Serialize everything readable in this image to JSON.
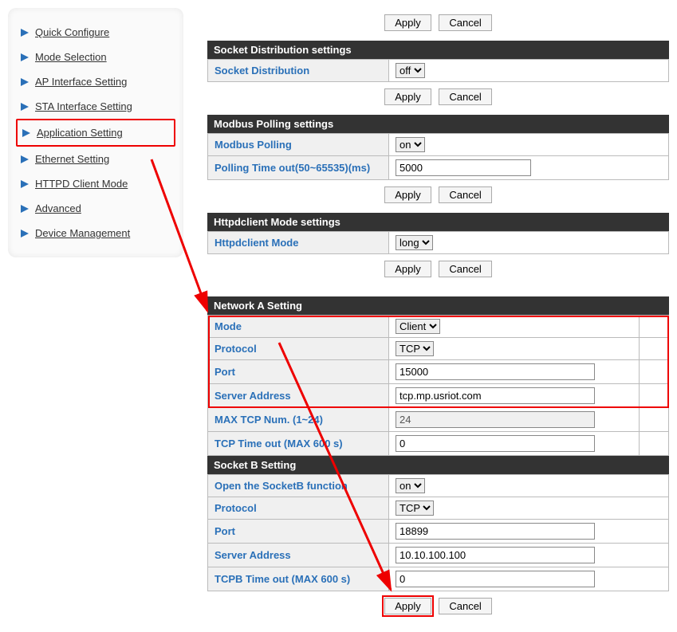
{
  "sidebar": {
    "items": [
      {
        "label": "Quick Configure"
      },
      {
        "label": "Mode Selection"
      },
      {
        "label": "AP Interface Setting"
      },
      {
        "label": "STA Interface Setting"
      },
      {
        "label": "Application Setting"
      },
      {
        "label": "Ethernet Setting"
      },
      {
        "label": "HTTPD Client Mode"
      },
      {
        "label": "Advanced"
      },
      {
        "label": "Device Management"
      }
    ]
  },
  "buttons": {
    "apply": "Apply",
    "cancel": "Cancel"
  },
  "sections": {
    "socketDist": {
      "header": "Socket Distribution settings",
      "row_label": "Socket Distribution",
      "value": "off"
    },
    "modbus": {
      "header": "Modbus Polling settings",
      "row1_label": "Modbus Polling",
      "row1_value": "on",
      "row2_label": "Polling Time out(50~65535)(ms)",
      "row2_value": "5000"
    },
    "httpd": {
      "header": "Httpdclient Mode settings",
      "row_label": "Httpdclient Mode",
      "value": "long"
    },
    "netA": {
      "header": "Network A Setting",
      "mode_label": "Mode",
      "mode_value": "Client",
      "proto_label": "Protocol",
      "proto_value": "TCP",
      "port_label": "Port",
      "port_value": "15000",
      "server_label": "Server Address",
      "server_value": "tcp.mp.usriot.com",
      "maxtcp_label": "MAX TCP Num. (1~24)",
      "maxtcp_value": "24",
      "timeout_label": "TCP Time out (MAX 600 s)",
      "timeout_value": "0"
    },
    "socketB": {
      "header": "Socket B Setting",
      "open_label": "Open the SocketB function",
      "open_value": "on",
      "proto_label": "Protocol",
      "proto_value": "TCP",
      "port_label": "Port",
      "port_value": "18899",
      "server_label": "Server Address",
      "server_value": "10.10.100.100",
      "timeout_label": "TCPB Time out (MAX 600 s)",
      "timeout_value": "0"
    }
  }
}
